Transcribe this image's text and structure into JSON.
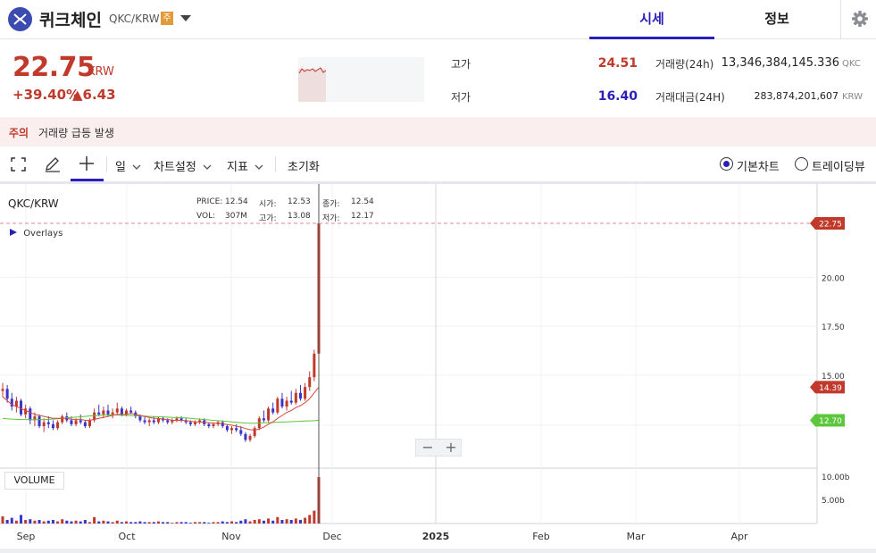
{
  "header": {
    "coin_name": "퀴크체인",
    "pair": "QKC/KRW",
    "warning_badge": "주",
    "tabs": [
      {
        "label": "시세",
        "active": true
      },
      {
        "label": "정보",
        "active": false
      }
    ]
  },
  "price": {
    "current": "22.75",
    "unit": "KRW",
    "change_pct": "+39.40%",
    "change_abs": "▲6.43"
  },
  "stats": {
    "high_label": "고가",
    "high_value": "24.51",
    "low_label": "저가",
    "low_value": "16.40",
    "volume_label": "거래량(24h)",
    "volume_value": "13,346,384,145.336",
    "volume_unit": "QKC",
    "trade_value_label": "거래대금(24H)",
    "trade_value_value": "283,874,201,607",
    "trade_value_unit": "KRW"
  },
  "notice": {
    "title": "주의",
    "text": "거래량 급등 발생"
  },
  "toolbar": {
    "interval": "일",
    "chart_settings": "차트설정",
    "indicators": "지표",
    "reset": "초기화",
    "chart_type_basic": "기본차트",
    "chart_type_tradingview": "트레이딩뷰",
    "selected_chart_type": "basic"
  },
  "chart_legend": {
    "pair": "QKC/KRW",
    "price_label": "PRICE:",
    "price_value": "12.54",
    "open_label": "시가:",
    "open_value": "12.53",
    "close_label": "종가:",
    "close_value": "12.54",
    "vol_label": "VOL:",
    "vol_value": "307M",
    "high_label": "고가:",
    "high_value": "13.08",
    "low_label": "저가:",
    "low_value": "12.17",
    "overlays": "Overlays",
    "volume_tag": "VOLUME",
    "zoom_out": "−",
    "zoom_in": "+"
  },
  "colors": {
    "accent": "#2c1fb8",
    "up": "#c0392b",
    "down": "#3a34c8",
    "ma_short": "#d9463a",
    "ma_long": "#5cc63c"
  },
  "chart_data": {
    "type": "candlestick",
    "x_ticks": [
      "Sep",
      "Oct",
      "Nov",
      "Dec",
      "2025",
      "Feb",
      "Mar",
      "Apr"
    ],
    "y_ticks": [
      "15.00",
      "17.50",
      "20.00"
    ],
    "volume_ticks": [
      "10.00b",
      "5.00b"
    ],
    "price_tags": [
      {
        "label": "22.75",
        "color": "#c0392b"
      },
      {
        "label": "14.39",
        "color": "#c0392b"
      },
      {
        "label": "12.70",
        "color": "#5cc63c"
      }
    ],
    "candles": [
      [
        14.2,
        14.6,
        13.9,
        14.3
      ],
      [
        14.3,
        14.5,
        13.6,
        13.8
      ],
      [
        13.8,
        14.1,
        13.2,
        13.4
      ],
      [
        13.4,
        13.9,
        13.1,
        13.7
      ],
      [
        13.7,
        13.8,
        12.9,
        13.0
      ],
      [
        13.0,
        13.5,
        12.8,
        13.3
      ],
      [
        13.3,
        13.4,
        12.5,
        12.7
      ],
      [
        12.7,
        13.1,
        12.4,
        12.9
      ],
      [
        12.9,
        13.0,
        12.3,
        12.4
      ],
      [
        12.4,
        12.8,
        12.1,
        12.6
      ],
      [
        12.6,
        12.9,
        12.3,
        12.5
      ],
      [
        12.5,
        12.7,
        12.2,
        12.3
      ],
      [
        12.3,
        12.7,
        12.2,
        12.6
      ],
      [
        12.6,
        13.0,
        12.5,
        12.9
      ],
      [
        12.9,
        13.1,
        12.6,
        12.7
      ],
      [
        12.7,
        12.9,
        12.4,
        12.5
      ],
      [
        12.5,
        12.8,
        12.4,
        12.7
      ],
      [
        12.7,
        13.0,
        12.5,
        12.6
      ],
      [
        12.6,
        12.7,
        12.3,
        12.4
      ],
      [
        12.4,
        12.8,
        12.3,
        12.7
      ],
      [
        12.7,
        13.3,
        12.6,
        13.1
      ],
      [
        13.1,
        13.5,
        12.9,
        13.0
      ],
      [
        13.0,
        13.4,
        12.8,
        13.2
      ],
      [
        13.2,
        13.5,
        12.9,
        13.0
      ],
      [
        13.0,
        13.3,
        12.8,
        13.1
      ],
      [
        13.1,
        13.6,
        13.0,
        13.3
      ],
      [
        13.3,
        13.4,
        12.9,
        13.0
      ],
      [
        13.0,
        13.3,
        12.9,
        13.2
      ],
      [
        13.2,
        13.4,
        13.0,
        13.1
      ],
      [
        13.1,
        13.2,
        12.8,
        12.9
      ],
      [
        12.9,
        13.0,
        12.6,
        12.7
      ],
      [
        12.7,
        12.9,
        12.5,
        12.6
      ],
      [
        12.6,
        12.8,
        12.4,
        12.7
      ],
      [
        12.7,
        12.9,
        12.5,
        12.6
      ],
      [
        12.6,
        12.9,
        12.5,
        12.8
      ],
      [
        12.8,
        12.9,
        12.6,
        12.7
      ],
      [
        12.7,
        12.8,
        12.5,
        12.6
      ],
      [
        12.6,
        12.8,
        12.5,
        12.7
      ],
      [
        12.7,
        12.9,
        12.6,
        12.8
      ],
      [
        12.8,
        12.9,
        12.6,
        12.7
      ],
      [
        12.7,
        12.8,
        12.5,
        12.6
      ],
      [
        12.6,
        12.7,
        12.4,
        12.5
      ],
      [
        12.5,
        12.7,
        12.4,
        12.6
      ],
      [
        12.6,
        12.8,
        12.5,
        12.7
      ],
      [
        12.7,
        12.8,
        12.4,
        12.5
      ],
      [
        12.5,
        12.6,
        12.3,
        12.4
      ],
      [
        12.4,
        12.6,
        12.3,
        12.5
      ],
      [
        12.5,
        12.7,
        12.4,
        12.6
      ],
      [
        12.6,
        12.7,
        12.3,
        12.4
      ],
      [
        12.4,
        12.5,
        12.1,
        12.2
      ],
      [
        12.2,
        12.4,
        12.0,
        12.3
      ],
      [
        12.3,
        12.5,
        12.1,
        12.2
      ],
      [
        12.2,
        12.4,
        11.9,
        12.0
      ],
      [
        12.0,
        12.1,
        11.6,
        11.7
      ],
      [
        11.7,
        12.0,
        11.6,
        11.9
      ],
      [
        11.9,
        12.4,
        11.8,
        12.3
      ],
      [
        12.3,
        12.9,
        12.2,
        12.8
      ],
      [
        12.8,
        13.2,
        12.6,
        12.7
      ],
      [
        12.7,
        13.4,
        12.6,
        13.3
      ],
      [
        13.3,
        13.6,
        13.0,
        13.1
      ],
      [
        13.1,
        13.9,
        13.0,
        13.8
      ],
      [
        13.8,
        14.1,
        13.3,
        13.4
      ],
      [
        13.4,
        13.9,
        13.2,
        13.7
      ],
      [
        13.7,
        14.2,
        13.5,
        13.6
      ],
      [
        13.6,
        14.3,
        13.5,
        14.1
      ],
      [
        14.1,
        14.5,
        13.7,
        13.8
      ],
      [
        13.8,
        14.6,
        13.7,
        14.4
      ],
      [
        14.4,
        15.2,
        14.2,
        14.9
      ],
      [
        14.9,
        16.3,
        14.7,
        16.1
      ],
      [
        16.1,
        24.51,
        16.0,
        22.75
      ]
    ],
    "volume_relative": [
      0.1,
      0.05,
      0.08,
      0.04,
      0.12,
      0.05,
      0.06,
      0.04,
      0.05,
      0.03,
      0.04,
      0.05,
      0.03,
      0.06,
      0.04,
      0.03,
      0.04,
      0.03,
      0.05,
      0.02,
      0.09,
      0.03,
      0.04,
      0.03,
      0.02,
      0.04,
      0.02,
      0.03,
      0.02,
      0.02,
      0.03,
      0.02,
      0.02,
      0.02,
      0.03,
      0.02,
      0.02,
      0.01,
      0.02,
      0.02,
      0.02,
      0.01,
      0.02,
      0.02,
      0.02,
      0.01,
      0.02,
      0.02,
      0.03,
      0.02,
      0.03,
      0.02,
      0.04,
      0.06,
      0.03,
      0.05,
      0.06,
      0.04,
      0.07,
      0.04,
      0.09,
      0.05,
      0.06,
      0.05,
      0.07,
      0.05,
      0.08,
      0.12,
      0.18,
      0.65
    ],
    "ma_short": [
      13.9,
      13.7,
      13.5,
      13.4,
      13.3,
      13.2,
      13.1,
      13.0,
      12.95,
      12.9,
      12.85,
      12.8,
      12.8,
      12.8,
      12.8,
      12.75,
      12.75,
      12.75,
      12.7,
      12.7,
      12.75,
      12.8,
      12.85,
      12.9,
      12.95,
      13.0,
      13.0,
      13.0,
      13.05,
      13.0,
      12.95,
      12.9,
      12.85,
      12.8,
      12.8,
      12.75,
      12.75,
      12.7,
      12.7,
      12.7,
      12.68,
      12.65,
      12.62,
      12.62,
      12.6,
      12.57,
      12.55,
      12.55,
      12.52,
      12.48,
      12.45,
      12.4,
      12.35,
      12.28,
      12.22,
      12.2,
      12.25,
      12.35,
      12.5,
      12.62,
      12.8,
      12.95,
      13.1,
      13.2,
      13.35,
      13.45,
      13.6,
      13.8,
      14.1,
      14.39
    ],
    "ma_long": [
      12.8,
      12.78,
      12.76,
      12.75,
      12.74,
      12.74,
      12.73,
      12.73,
      12.73,
      12.74,
      12.75,
      12.76,
      12.78,
      12.8,
      12.82,
      12.84,
      12.86,
      12.88,
      12.9,
      12.92,
      12.94,
      12.95,
      12.96,
      12.97,
      12.97,
      12.97,
      12.96,
      12.95,
      12.94,
      12.93,
      12.92,
      12.91,
      12.9,
      12.89,
      12.88,
      12.87,
      12.86,
      12.85,
      12.84,
      12.83,
      12.82,
      12.8,
      12.78,
      12.76,
      12.74,
      12.72,
      12.7,
      12.68,
      12.66,
      12.64,
      12.62,
      12.6,
      12.58,
      12.56,
      12.55,
      12.55,
      12.56,
      12.57,
      12.58,
      12.59,
      12.6,
      12.61,
      12.62,
      12.63,
      12.64,
      12.65,
      12.66,
      12.67,
      12.68,
      12.7
    ],
    "y_range": [
      10.0,
      24.5
    ]
  }
}
